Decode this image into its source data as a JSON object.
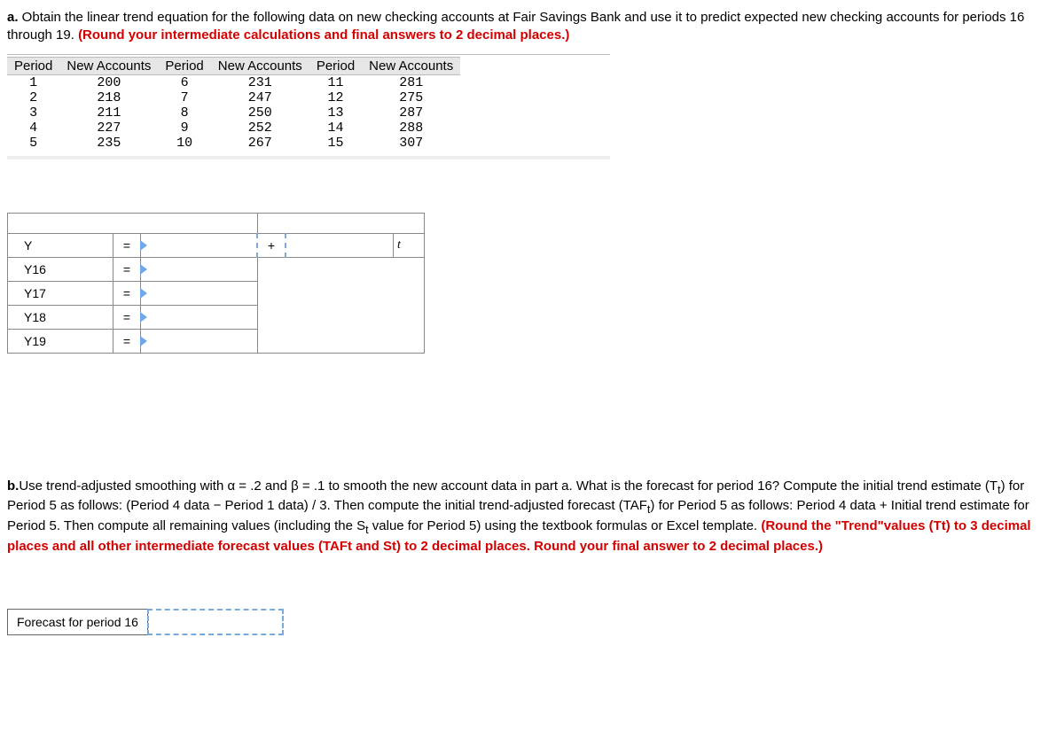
{
  "q_a": {
    "label": "a.",
    "text1": " Obtain the linear trend equation for the following data on new checking accounts at Fair Savings Bank and use it to predict expected new checking accounts for periods 16 through 19. ",
    "red": "(Round your intermediate calculations and final answers to 2 decimal places.)"
  },
  "table": {
    "h_period": "Period",
    "h_accounts": "New Accounts",
    "rows": [
      {
        "p1": "1",
        "a1": "200",
        "p2": "6",
        "a2": "231",
        "p3": "11",
        "a3": "281"
      },
      {
        "p1": "2",
        "a1": "218",
        "p2": "7",
        "a2": "247",
        "p3": "12",
        "a3": "275"
      },
      {
        "p1": "3",
        "a1": "211",
        "p2": "8",
        "a2": "250",
        "p3": "13",
        "a3": "287"
      },
      {
        "p1": "4",
        "a1": "227",
        "p2": "9",
        "a2": "252",
        "p3": "14",
        "a3": "288"
      },
      {
        "p1": "5",
        "a1": "235",
        "p2": "10",
        "a2": "267",
        "p3": "15",
        "a3": "307"
      }
    ]
  },
  "ans": {
    "eq": "=",
    "plus": "+",
    "t": "t",
    "rows": [
      {
        "label": "Y"
      },
      {
        "label": "Y16"
      },
      {
        "label": "Y17"
      },
      {
        "label": "Y18"
      },
      {
        "label": "Y19"
      }
    ]
  },
  "q_b": {
    "label": "b.",
    "text1": "Use trend-adjusted smoothing with α = .2 and β = .1 to smooth the new account data in part a. What is the forecast for period 16? Compute the initial trend estimate (T",
    "sub1": "t",
    "text2": ") for Period 5 as follows: (Period 4 data − Period 1 data) / 3. Then compute the initial trend-adjusted forecast (TAF",
    "sub2": "t",
    "text3": ") for Period 5 as follows: Period 4 data + Initial trend estimate for Period 5. Then compute all remaining values (including the S",
    "sub3": "t",
    "text4": " value for Period 5) using the textbook formulas or Excel template. ",
    "red": "(Round the \"Trend\"values (Tt) to 3 decimal places and all other intermediate forecast values (TAFt and St) to 2 decimal places.  Round your final answer to 2 decimal places.)"
  },
  "forecast_label": "Forecast for period 16"
}
